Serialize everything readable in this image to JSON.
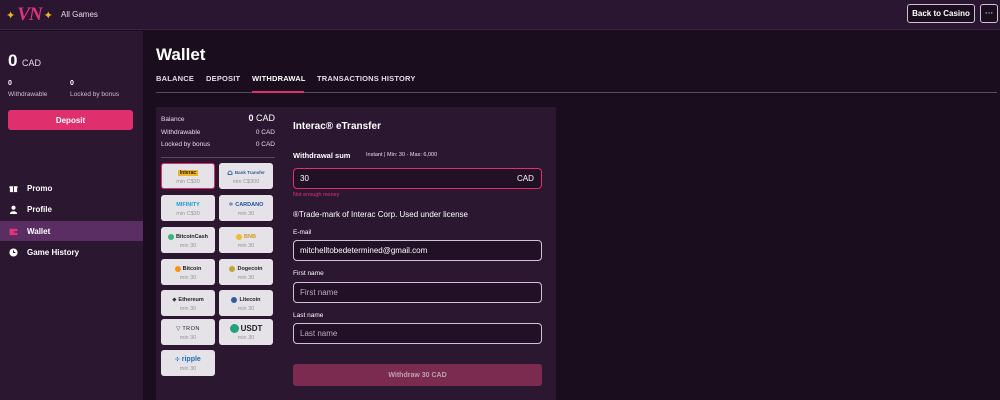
{
  "header": {
    "logo_text": "VN",
    "all_games": "All Games",
    "back_label": "Back to Casino",
    "more_label": "···"
  },
  "sidebar": {
    "balance_amount": "0",
    "balance_currency": "CAD",
    "withdrawable_value": "0",
    "withdrawable_label": "Withdrawable",
    "locked_value": "0",
    "locked_label": "Locked by bonus",
    "deposit_label": "Deposit",
    "nav": [
      {
        "label": "Promo",
        "icon": "gift-icon",
        "active": false
      },
      {
        "label": "Profile",
        "icon": "user-icon",
        "active": false
      },
      {
        "label": "Wallet",
        "icon": "wallet-icon",
        "active": true
      },
      {
        "label": "Game History",
        "icon": "clock-icon",
        "active": false
      }
    ]
  },
  "main": {
    "title": "Wallet",
    "tabs": [
      {
        "label": "BALANCE"
      },
      {
        "label": "DEPOSIT"
      },
      {
        "label": "WITHDRAWAL"
      },
      {
        "label": "TRANSACTIONS HISTORY"
      }
    ],
    "active_tab": "WITHDRAWAL"
  },
  "summary": {
    "balance_label": "Balance",
    "balance_value": "0",
    "balance_currency": "CAD",
    "withdrawable_label": "Withdrawable",
    "withdrawable_value": "0 CAD",
    "locked_label": "Locked by bonus",
    "locked_value": "0 CAD"
  },
  "methods": [
    {
      "name": "Interac e-Transfer",
      "logo": "Interac",
      "min": "min C$30",
      "selected": true
    },
    {
      "name": "Bank Transfer",
      "logo": "Bank Transfer",
      "min": "min C$300",
      "selected": false
    },
    {
      "name": "MiFinity",
      "logo": "MIFINITY",
      "min": "min C$30",
      "selected": false
    },
    {
      "name": "Cardano",
      "logo": "CARDANO",
      "min": "min 30",
      "selected": false
    },
    {
      "name": "Bitcoin Cash",
      "logo": "BitcoinCash",
      "min": "min 30",
      "selected": false
    },
    {
      "name": "BNB",
      "logo": "BNB",
      "min": "min 30",
      "selected": false
    },
    {
      "name": "Bitcoin",
      "logo": "Bitcoin",
      "min": "min 30",
      "selected": false
    },
    {
      "name": "Dogecoin",
      "logo": "Dogecoin",
      "min": "min 30",
      "selected": false
    },
    {
      "name": "Ethereum",
      "logo": "Ethereum",
      "min": "min 30",
      "selected": false
    },
    {
      "name": "Litecoin",
      "logo": "Litecoin",
      "min": "min 30",
      "selected": false
    },
    {
      "name": "Tron",
      "logo": "TRON",
      "min": "min 30",
      "selected": false
    },
    {
      "name": "USDT",
      "logo": "USDT",
      "min": "min 30",
      "selected": false
    },
    {
      "name": "Ripple",
      "logo": "ripple",
      "min": "min 30",
      "selected": false
    }
  ],
  "form": {
    "title": "Interac® eTransfer",
    "sum_label": "Withdrawal sum",
    "sum_info": "Instant | Min: 30 - Max: 6,000",
    "amount": "30",
    "currency": "CAD",
    "error": "Not enough money",
    "trademark": "®Trade-mark of Interac Corp. Used under license",
    "email_label": "E-mail",
    "email_value": "mitchelltobedetermined@gmail.com",
    "first_name_label": "First name",
    "first_name_placeholder": "First name",
    "last_name_label": "Last name",
    "last_name_placeholder": "Last name",
    "submit_label": "Withdraw 30 CAD"
  },
  "colors": {
    "accent": "#df2f6c",
    "sidebar_bg": "#2c1731",
    "page_bg": "#1a0d1e",
    "active_nav": "#5a2e63"
  }
}
